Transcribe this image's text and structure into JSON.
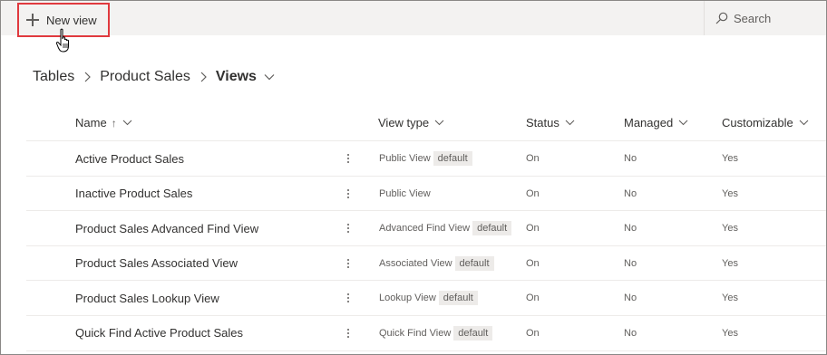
{
  "toolbar": {
    "new_view_label": "New view",
    "search_placeholder": "Search"
  },
  "breadcrumb": {
    "items": [
      "Tables",
      "Product Sales"
    ],
    "current": "Views"
  },
  "table": {
    "headers": {
      "name": "Name",
      "view_type": "View type",
      "status": "Status",
      "managed": "Managed",
      "customizable": "Customizable"
    },
    "sort_arrow": "↑",
    "rows": [
      {
        "name": "Active Product Sales",
        "view_type": "Public View",
        "badge": "default",
        "status": "On",
        "managed": "No",
        "customizable": "Yes"
      },
      {
        "name": "Inactive Product Sales",
        "view_type": "Public View",
        "badge": "",
        "status": "On",
        "managed": "No",
        "customizable": "Yes"
      },
      {
        "name": "Product Sales Advanced Find View",
        "view_type": "Advanced Find View",
        "badge": "default",
        "status": "On",
        "managed": "No",
        "customizable": "Yes"
      },
      {
        "name": "Product Sales Associated View",
        "view_type": "Associated View",
        "badge": "default",
        "status": "On",
        "managed": "No",
        "customizable": "Yes"
      },
      {
        "name": "Product Sales Lookup View",
        "view_type": "Lookup View",
        "badge": "default",
        "status": "On",
        "managed": "No",
        "customizable": "Yes"
      },
      {
        "name": "Quick Find Active Product Sales",
        "view_type": "Quick Find View",
        "badge": "default",
        "status": "On",
        "managed": "No",
        "customizable": "Yes"
      }
    ]
  },
  "colors": {
    "highlight_border": "#e0393e",
    "commandbar_bg": "#f3f2f1",
    "badge_bg": "#edebe9"
  }
}
